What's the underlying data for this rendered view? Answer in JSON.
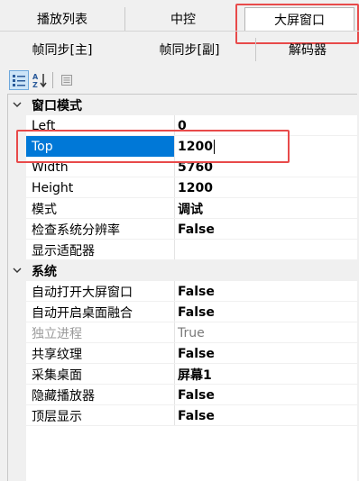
{
  "tabs": {
    "row1": [
      "播放列表",
      "中控",
      "大屏窗口"
    ],
    "row2": [
      "帧同步[主]",
      "帧同步[副]",
      "解码器"
    ],
    "active": "大屏窗口"
  },
  "toolbar": {
    "categorized_icon": "categorized-icon",
    "sort_icon": "alphabetical-sort-icon",
    "pages_icon": "property-pages-icon"
  },
  "grid": {
    "categories": [
      {
        "label": "窗口模式",
        "props": [
          {
            "name": "Left",
            "value": "0"
          },
          {
            "name": "Top",
            "value": "1200"
          },
          {
            "name": "Width",
            "value": "5760"
          },
          {
            "name": "Height",
            "value": "1200"
          },
          {
            "name": "模式",
            "value": "调试"
          },
          {
            "name": "检查系统分辨率",
            "value": "False"
          },
          {
            "name": "显示适配器",
            "value": ""
          }
        ]
      },
      {
        "label": "系统",
        "props": [
          {
            "name": "自动打开大屏窗口",
            "value": "False"
          },
          {
            "name": "自动开启桌面融合",
            "value": "False"
          },
          {
            "name": "独立进程",
            "value": "True"
          },
          {
            "name": "共享纹理",
            "value": "False"
          },
          {
            "name": "采集桌面",
            "value": "屏幕1"
          },
          {
            "name": "隐藏播放器",
            "value": "False"
          },
          {
            "name": "顶层显示",
            "value": "False"
          }
        ]
      }
    ]
  },
  "colors": {
    "selection": "#0078d7",
    "highlight_box": "#e84a4a"
  }
}
